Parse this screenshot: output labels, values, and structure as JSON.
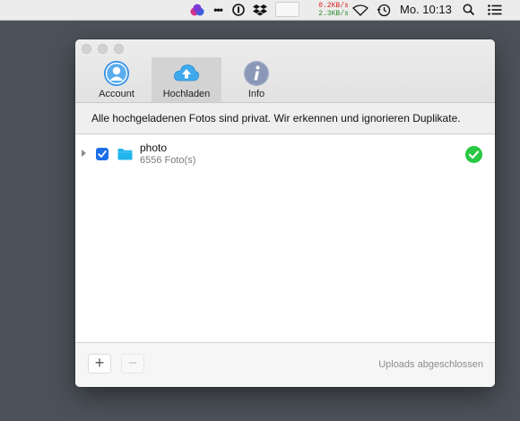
{
  "menubar": {
    "icons": [
      "creative-cloud-icon",
      "more-dots-icon",
      "onepassword-icon",
      "dropbox-icon",
      "blank-status-item",
      "wifi-icon",
      "time-machine-icon",
      "spotlight-icon",
      "notification-center-icon"
    ],
    "more_dots": "•••",
    "net_up": "0.2KB/s",
    "net_down": "2.3KB/s",
    "clock": "Mo. 10:13"
  },
  "window": {
    "tabs": [
      {
        "label": "Account",
        "icon": "account-icon",
        "active": false
      },
      {
        "label": "Hochladen",
        "icon": "upload-cloud-icon",
        "active": true
      },
      {
        "label": "Info",
        "icon": "info-icon",
        "active": false
      }
    ],
    "notice": "Alle hochgeladenen Fotos sind privat. Wir erkennen und ignorieren Duplikate.",
    "folders": [
      {
        "name": "photo",
        "count": "6556 Foto(s)",
        "checked": true,
        "status": "complete"
      }
    ],
    "footer": {
      "add": "+",
      "remove": "−",
      "status": "Uploads abgeschlossen"
    }
  },
  "colors": {
    "desktop": "#4d525a",
    "checkbox": "#1d6fe8",
    "folder": "#1fb4ec",
    "success": "#28c840"
  }
}
